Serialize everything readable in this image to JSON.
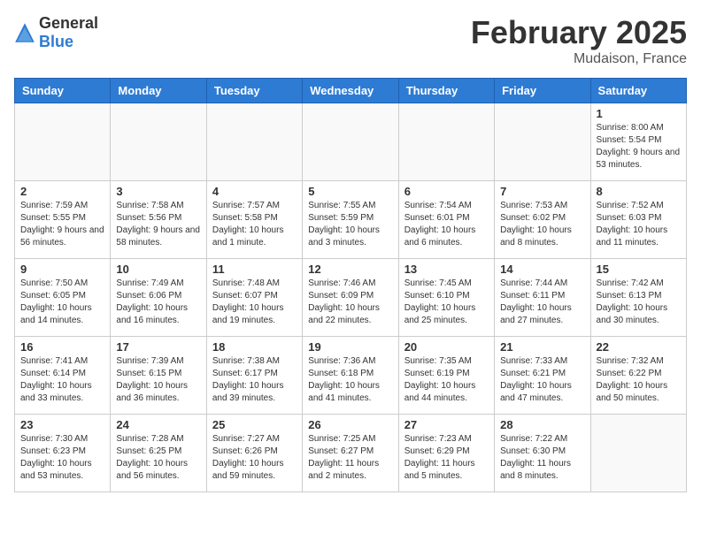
{
  "header": {
    "logo_general": "General",
    "logo_blue": "Blue",
    "month_title": "February 2025",
    "location": "Mudaison, France"
  },
  "weekdays": [
    "Sunday",
    "Monday",
    "Tuesday",
    "Wednesday",
    "Thursday",
    "Friday",
    "Saturday"
  ],
  "weeks": [
    [
      {
        "day": "",
        "info": ""
      },
      {
        "day": "",
        "info": ""
      },
      {
        "day": "",
        "info": ""
      },
      {
        "day": "",
        "info": ""
      },
      {
        "day": "",
        "info": ""
      },
      {
        "day": "",
        "info": ""
      },
      {
        "day": "1",
        "info": "Sunrise: 8:00 AM\nSunset: 5:54 PM\nDaylight: 9 hours and 53 minutes."
      }
    ],
    [
      {
        "day": "2",
        "info": "Sunrise: 7:59 AM\nSunset: 5:55 PM\nDaylight: 9 hours and 56 minutes."
      },
      {
        "day": "3",
        "info": "Sunrise: 7:58 AM\nSunset: 5:56 PM\nDaylight: 9 hours and 58 minutes."
      },
      {
        "day": "4",
        "info": "Sunrise: 7:57 AM\nSunset: 5:58 PM\nDaylight: 10 hours and 1 minute."
      },
      {
        "day": "5",
        "info": "Sunrise: 7:55 AM\nSunset: 5:59 PM\nDaylight: 10 hours and 3 minutes."
      },
      {
        "day": "6",
        "info": "Sunrise: 7:54 AM\nSunset: 6:01 PM\nDaylight: 10 hours and 6 minutes."
      },
      {
        "day": "7",
        "info": "Sunrise: 7:53 AM\nSunset: 6:02 PM\nDaylight: 10 hours and 8 minutes."
      },
      {
        "day": "8",
        "info": "Sunrise: 7:52 AM\nSunset: 6:03 PM\nDaylight: 10 hours and 11 minutes."
      }
    ],
    [
      {
        "day": "9",
        "info": "Sunrise: 7:50 AM\nSunset: 6:05 PM\nDaylight: 10 hours and 14 minutes."
      },
      {
        "day": "10",
        "info": "Sunrise: 7:49 AM\nSunset: 6:06 PM\nDaylight: 10 hours and 16 minutes."
      },
      {
        "day": "11",
        "info": "Sunrise: 7:48 AM\nSunset: 6:07 PM\nDaylight: 10 hours and 19 minutes."
      },
      {
        "day": "12",
        "info": "Sunrise: 7:46 AM\nSunset: 6:09 PM\nDaylight: 10 hours and 22 minutes."
      },
      {
        "day": "13",
        "info": "Sunrise: 7:45 AM\nSunset: 6:10 PM\nDaylight: 10 hours and 25 minutes."
      },
      {
        "day": "14",
        "info": "Sunrise: 7:44 AM\nSunset: 6:11 PM\nDaylight: 10 hours and 27 minutes."
      },
      {
        "day": "15",
        "info": "Sunrise: 7:42 AM\nSunset: 6:13 PM\nDaylight: 10 hours and 30 minutes."
      }
    ],
    [
      {
        "day": "16",
        "info": "Sunrise: 7:41 AM\nSunset: 6:14 PM\nDaylight: 10 hours and 33 minutes."
      },
      {
        "day": "17",
        "info": "Sunrise: 7:39 AM\nSunset: 6:15 PM\nDaylight: 10 hours and 36 minutes."
      },
      {
        "day": "18",
        "info": "Sunrise: 7:38 AM\nSunset: 6:17 PM\nDaylight: 10 hours and 39 minutes."
      },
      {
        "day": "19",
        "info": "Sunrise: 7:36 AM\nSunset: 6:18 PM\nDaylight: 10 hours and 41 minutes."
      },
      {
        "day": "20",
        "info": "Sunrise: 7:35 AM\nSunset: 6:19 PM\nDaylight: 10 hours and 44 minutes."
      },
      {
        "day": "21",
        "info": "Sunrise: 7:33 AM\nSunset: 6:21 PM\nDaylight: 10 hours and 47 minutes."
      },
      {
        "day": "22",
        "info": "Sunrise: 7:32 AM\nSunset: 6:22 PM\nDaylight: 10 hours and 50 minutes."
      }
    ],
    [
      {
        "day": "23",
        "info": "Sunrise: 7:30 AM\nSunset: 6:23 PM\nDaylight: 10 hours and 53 minutes."
      },
      {
        "day": "24",
        "info": "Sunrise: 7:28 AM\nSunset: 6:25 PM\nDaylight: 10 hours and 56 minutes."
      },
      {
        "day": "25",
        "info": "Sunrise: 7:27 AM\nSunset: 6:26 PM\nDaylight: 10 hours and 59 minutes."
      },
      {
        "day": "26",
        "info": "Sunrise: 7:25 AM\nSunset: 6:27 PM\nDaylight: 11 hours and 2 minutes."
      },
      {
        "day": "27",
        "info": "Sunrise: 7:23 AM\nSunset: 6:29 PM\nDaylight: 11 hours and 5 minutes."
      },
      {
        "day": "28",
        "info": "Sunrise: 7:22 AM\nSunset: 6:30 PM\nDaylight: 11 hours and 8 minutes."
      },
      {
        "day": "",
        "info": ""
      }
    ]
  ]
}
